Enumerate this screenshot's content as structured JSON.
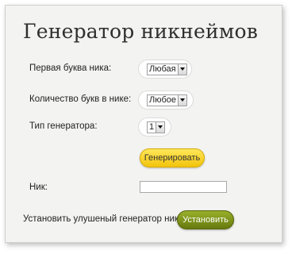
{
  "title": "Генератор никнеймов",
  "fields": {
    "first_letter": {
      "label": "Первая буква ника:",
      "value": "Любая"
    },
    "letter_count": {
      "label": "Количество букв в нике:",
      "value": "Любое"
    },
    "generator_type": {
      "label": "Тип генератора:",
      "value": "1"
    }
  },
  "generate_button": "Генерировать",
  "nick": {
    "label": "Ник:",
    "value": ""
  },
  "install": {
    "label": "Установить улушеный генератор ников:",
    "button": "Установить"
  },
  "colors": {
    "yellow_button": "#f2c40c",
    "green_button": "#7a8f18",
    "panel_bg": "#f3f3f1"
  }
}
